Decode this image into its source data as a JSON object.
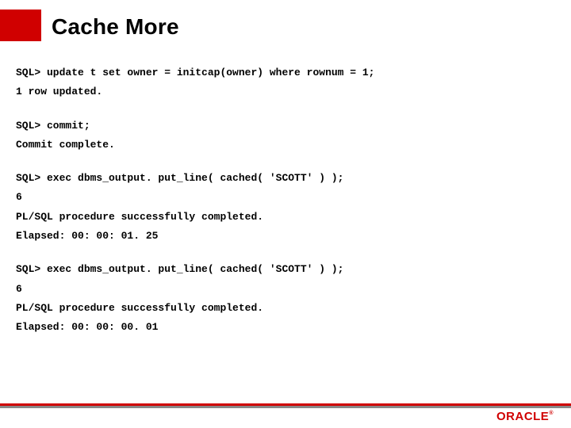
{
  "title": "Cache More",
  "lines": {
    "l0": "SQL> update t set owner = initcap(owner) where rownum = 1;",
    "l1": "1 row updated.",
    "l2": "SQL> commit;",
    "l3": "Commit complete.",
    "l4": "SQL> exec dbms_output. put_line( cached( 'SCOTT' ) );",
    "l5": "6",
    "l6": "PL/SQL procedure successfully completed.",
    "l7": "Elapsed: 00: 00: 01. 25",
    "l8": "SQL> exec dbms_output. put_line( cached( 'SCOTT' ) );",
    "l9": "6",
    "l10": "PL/SQL procedure successfully completed.",
    "l11": "Elapsed: 00: 00: 00. 01"
  },
  "logo": "ORACLE",
  "logo_mark": "®"
}
